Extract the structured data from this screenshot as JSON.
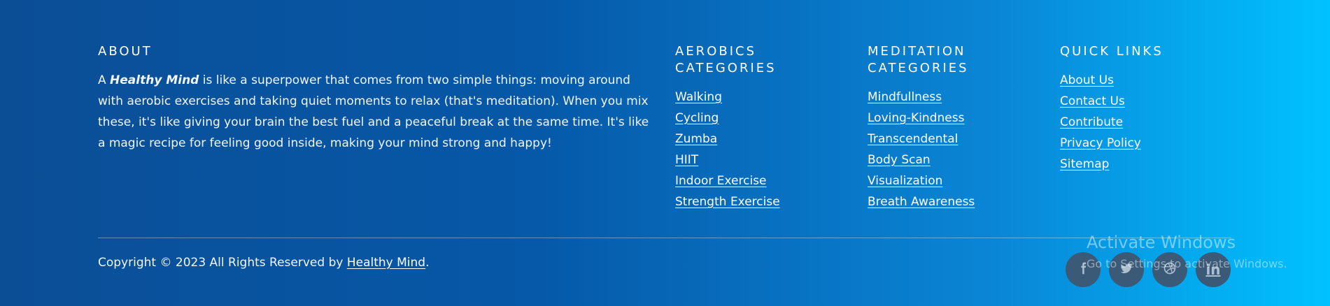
{
  "about": {
    "heading": "ABOUT",
    "text_prefix": "A",
    "brand": "Healthy Mind",
    "text_body": "is like a superpower that comes from two simple things: moving around with aerobic exercises and taking quiet moments to relax (that's meditation). When you mix these, it's like giving your brain the best fuel and a peaceful break at the same time. It's like a magic recipe for feeling good inside, making your mind strong and happy!"
  },
  "aerobics": {
    "heading_line1": "AEROBICS",
    "heading_line2": "CATEGORIES",
    "links": [
      "Walking",
      "Cycling",
      "Zumba",
      "HIIT",
      "Indoor Exercise",
      "Strength Exercise"
    ]
  },
  "meditation": {
    "heading_line1": "MEDITATION",
    "heading_line2": "CATEGORIES",
    "links": [
      "Mindfullness",
      "Loving-Kindness",
      "Transcendental",
      "Body Scan",
      "Visualization",
      "Breath Awareness"
    ]
  },
  "quick_links": {
    "heading": "QUICK LINKS",
    "links": [
      "About Us",
      "Contact Us",
      "Contribute",
      "Privacy Policy",
      "Sitemap"
    ]
  },
  "copyright": {
    "prefix": "Copyright © 2023 All Rights Reserved by",
    "brand": "Healthy Mind",
    "suffix": "."
  },
  "social": {
    "icons": [
      "facebook-icon",
      "twitter-icon",
      "dribbble-icon",
      "linkedin-icon"
    ],
    "linkedin_glyph": "in"
  },
  "watermark": {
    "title": "Activate Windows",
    "subtitle": "Go to Settings to activate Windows."
  },
  "colors": {
    "gradient_start": "#0b4e96",
    "gradient_end": "#00c2ff",
    "social_bg": "#3b5a78"
  }
}
